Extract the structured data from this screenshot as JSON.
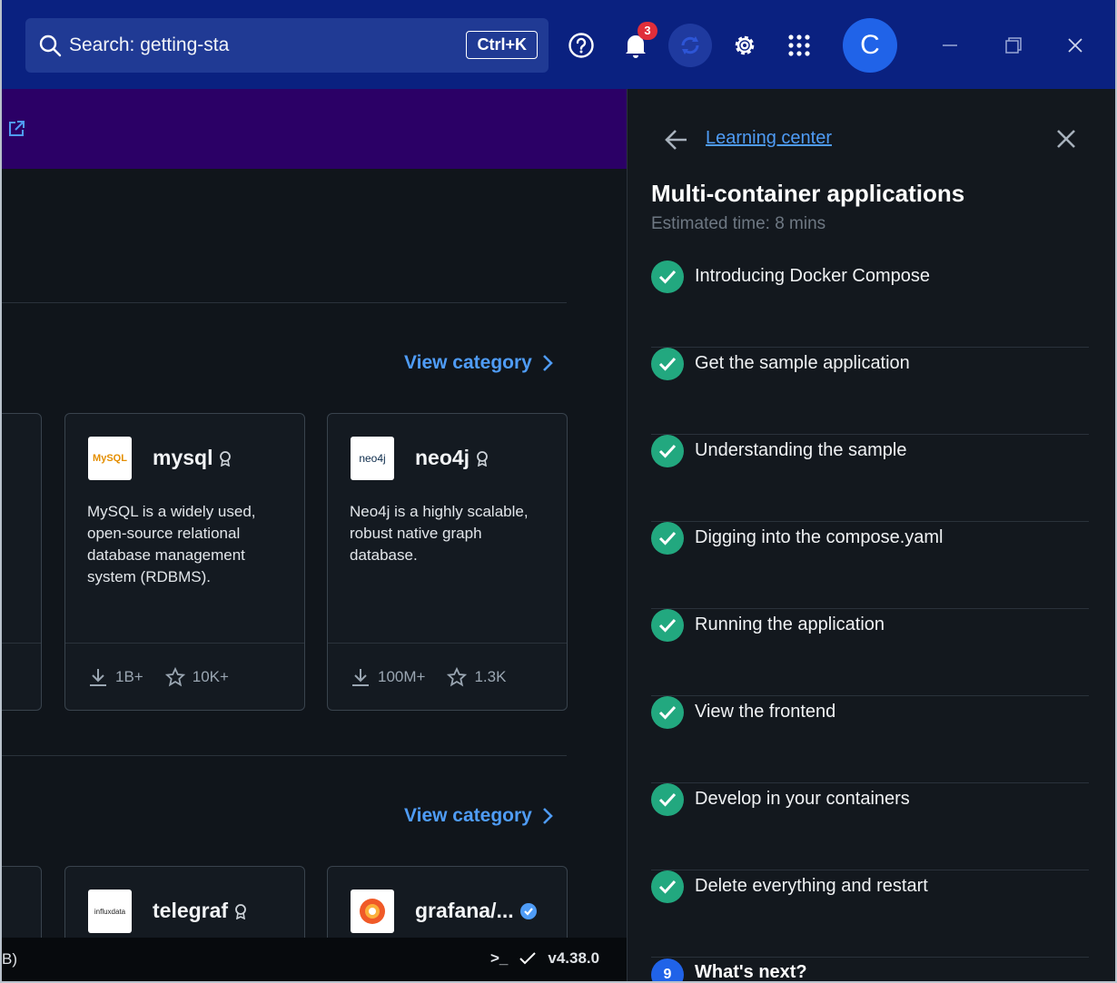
{
  "topbar": {
    "search_text": "Search: getting-sta",
    "shortcut": "Ctrl+K",
    "notification_count": "3",
    "avatar_letter": "C"
  },
  "categories": [
    {
      "view_label": "View category",
      "cards": [
        {
          "logo_text": "MySQL",
          "name": "mysql",
          "description": "MySQL is a widely used, open-source relational database management system (RDBMS).",
          "pulls": "1B+",
          "stars": "10K+"
        },
        {
          "logo_text": "neo4j",
          "name": "neo4j",
          "description": "Neo4j is a highly scalable, robust native graph database.",
          "pulls": "100M+",
          "stars": "1.3K"
        }
      ]
    },
    {
      "view_label": "View category",
      "cards": [
        {
          "logo_text": "influxdata",
          "name": "telegraf"
        },
        {
          "logo_text": "",
          "name": "grafana/..."
        }
      ]
    }
  ],
  "statusbar": {
    "left_text": "B)",
    "terminal": ">_",
    "version": "v4.38.0"
  },
  "panel": {
    "breadcrumb": "Learning center",
    "title": "Multi-container applications",
    "estimate": "Estimated time: 8 mins",
    "steps": [
      "Introducing Docker Compose",
      "Get the sample application",
      "Understanding the sample",
      "Digging into the compose.yaml",
      "Running the application",
      "View the frontend",
      "Develop in your containers",
      "Delete everything and restart"
    ],
    "next_number": "9",
    "next_label": "What's next?"
  },
  "colors": {
    "topbar": "#0a2180",
    "banner": "#2b0066",
    "accent_link": "#4f9cf6",
    "check_green": "#22a87f",
    "badge_red": "#e02e3a"
  }
}
